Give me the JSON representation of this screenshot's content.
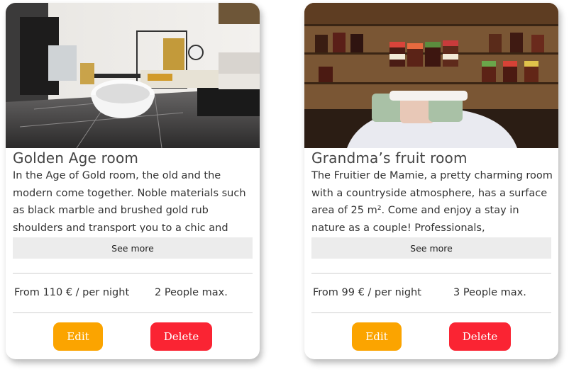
{
  "colors": {
    "edit_button": "#fba400",
    "delete_button": "#fa2433",
    "see_more_bg": "#ececec",
    "title_text": "#444444"
  },
  "rooms": [
    {
      "title": "Golden Age room",
      "description": "In the Age of Gold room, the old and the modern come together. Noble materials such as black marble and brushed gold rub shoulders and transport you to a chic and",
      "see_more_label": "See more",
      "price": "From 110 € / per night",
      "capacity": "2 People max.",
      "edit_label": "Edit",
      "delete_label": "Delete"
    },
    {
      "title": "Grandma’s fruit room",
      "description": "The Fruitier de Mamie, a pretty charming room with a countryside atmosphere, has a surface area of 25 m². Come and enjoy a stay in nature as a couple! Professionals,",
      "see_more_label": "See more",
      "price": "From 99 € / per night",
      "capacity": "3 People max.",
      "edit_label": "Edit",
      "delete_label": "Delete"
    }
  ]
}
